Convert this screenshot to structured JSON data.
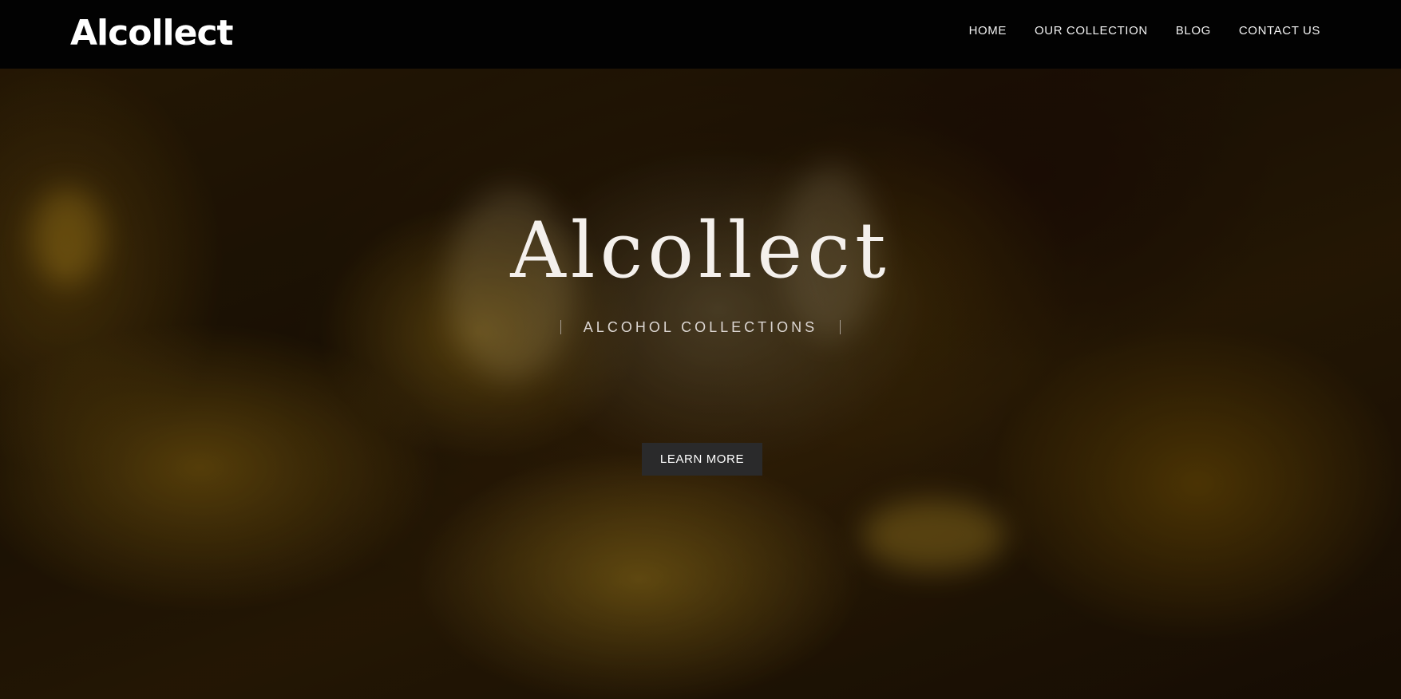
{
  "header": {
    "brand": "Alcollect",
    "nav": [
      {
        "label": "HOME"
      },
      {
        "label": "OUR COLLECTION"
      },
      {
        "label": "BLOG"
      },
      {
        "label": "CONTACT US"
      }
    ]
  },
  "hero": {
    "title": "Alcollect",
    "subtitle": "ALCOHOL COLLECTIONS",
    "cta_label": "LEARN MORE",
    "background_image": "whisky-with-ice-closeup"
  },
  "colors": {
    "navbar_bg": "#020202",
    "button_bg": "#2a2a2b",
    "text_light": "#f4f0ec"
  }
}
